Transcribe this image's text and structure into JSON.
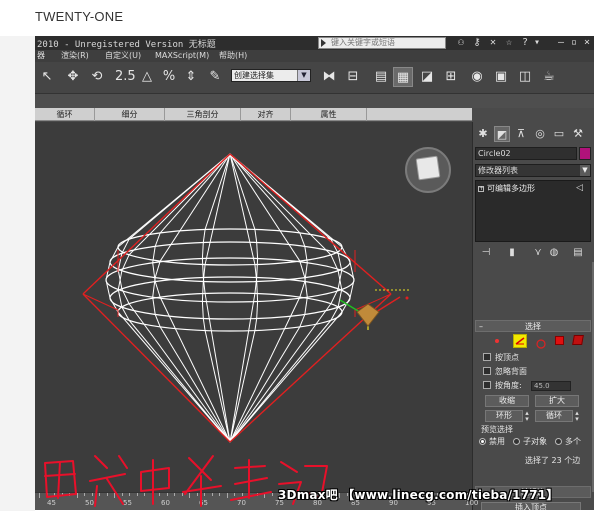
{
  "page_label": "TWENTY-ONE",
  "title": {
    "text": "2010  - Unregistered Version  无标题",
    "search_placeholder": "键入关键字或短语",
    "window_controls": [
      "–",
      "▫",
      "×"
    ]
  },
  "menus": [
    "器",
    "渲染(R)",
    "自定义(U)",
    "MAXScript(M)",
    "帮助(H)"
  ],
  "toolbar": {
    "selection_set": "创建选择集",
    "snap_label": "2.5"
  },
  "ribbon_tabs": [
    "循环",
    "细分",
    "三角剖分",
    "对齐",
    "属性"
  ],
  "command_panel": {
    "object_name": "Circle02",
    "object_color": "#b0127a",
    "modifier_list": "修改器列表",
    "stack_item": "可编辑多边形",
    "selection": {
      "title": "选择",
      "by_vertex": "按顶点",
      "ignore_backfacing": "忽略背面",
      "by_angle": "按角度:",
      "angle_value": "45.0",
      "shrink": "收缩",
      "grow": "扩大",
      "ring": "环形",
      "loop": "循环",
      "preview_title": "预览选择",
      "preview_off": "禁用",
      "preview_subobj": "子对象",
      "preview_multi": "多个",
      "status": "选择了 23 个边"
    },
    "edit_edges": {
      "title": "编辑边",
      "insert_vertex": "插入顶点"
    }
  },
  "timeline": {
    "ticks": [
      "45",
      "50",
      "55",
      "60",
      "65",
      "70",
      "75",
      "80",
      "85",
      "90",
      "95",
      "100"
    ]
  },
  "watermark": "3Dmax吧  【www.linecg.com/tieba/1771】"
}
